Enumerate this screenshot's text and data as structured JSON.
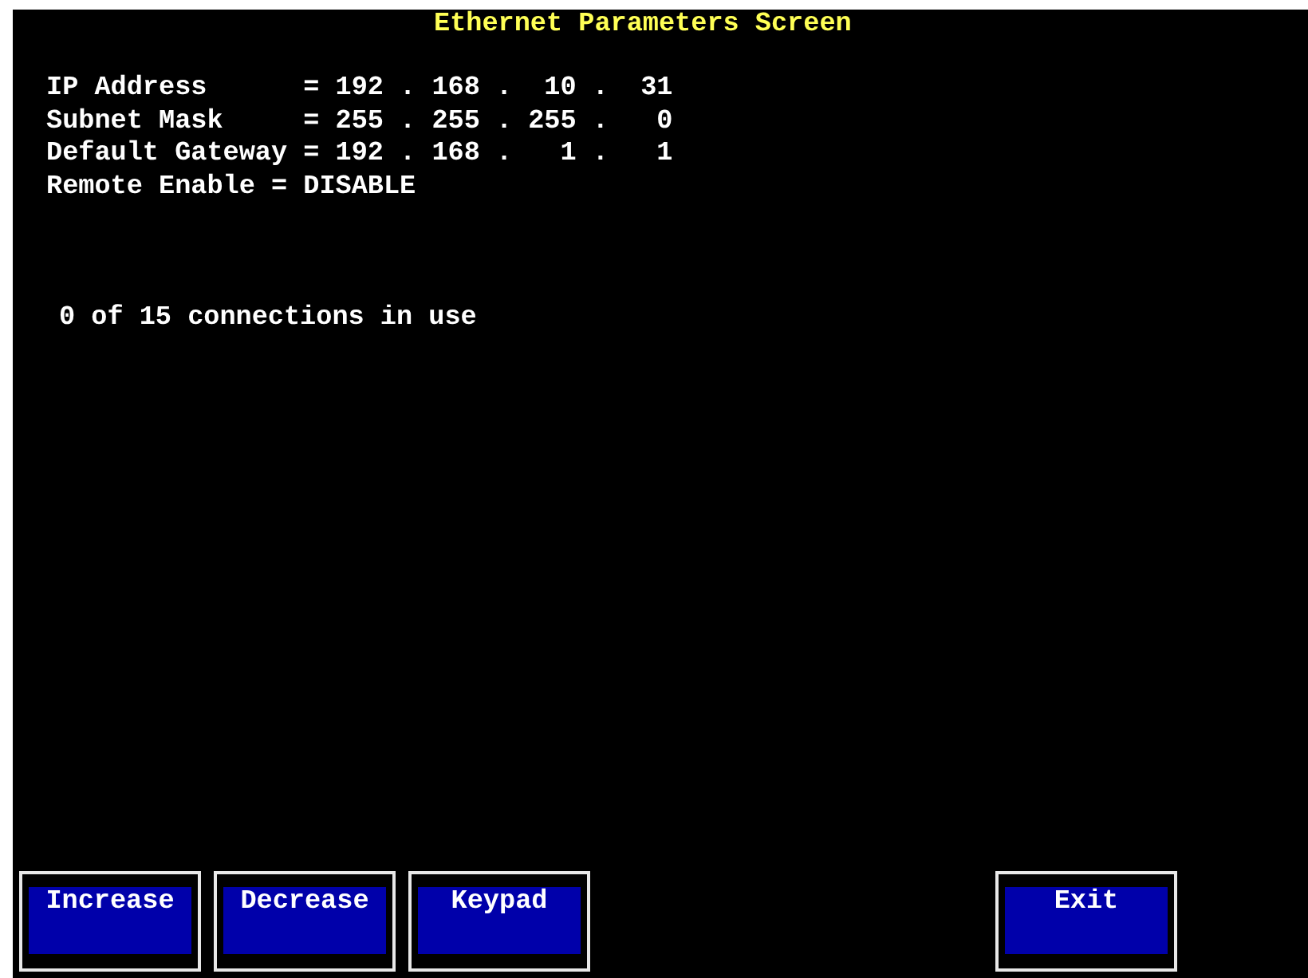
{
  "title": "Ethernet Parameters Screen",
  "parameters": [
    "IP Address      = 192 . 168 .  10 .  31",
    "Subnet Mask     = 255 . 255 . 255 .   0",
    "Default Gateway = 192 . 168 .   1 .   1",
    "Remote Enable = DISABLE"
  ],
  "status": "0 of 15 connections in use",
  "left_buttons": [
    "Increase",
    "Decrease",
    "Keypad"
  ],
  "right_buttons": [
    "Exit"
  ]
}
